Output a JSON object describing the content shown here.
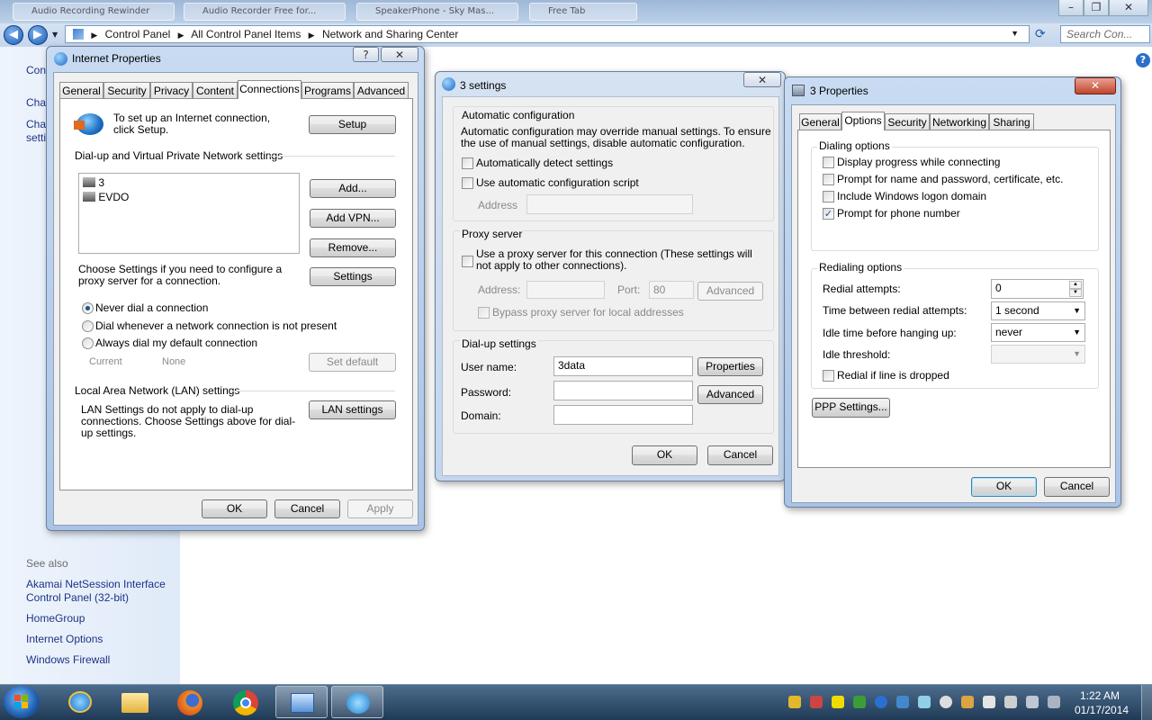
{
  "explorer": {
    "tabs": [
      "Audio Recording Rewinder",
      "Audio Recorder Free for...",
      "SpeakerPhone - Sky Mas...",
      "Free Tab"
    ],
    "breadcrumb": [
      "Control Panel",
      "All Control Panel Items",
      "Network and Sharing Center"
    ],
    "search_placeholder": "Search Con...",
    "left_partial": [
      "Con",
      "Cha",
      "Cha",
      "setti"
    ],
    "see_also_label": "See also",
    "see_also_links": [
      "Akamai NetSession Interface Control Panel (32-bit)",
      "HomeGroup",
      "Internet Options",
      "Windows Firewall"
    ]
  },
  "inet": {
    "title": "Internet Properties",
    "tabs": [
      "General",
      "Security",
      "Privacy",
      "Content",
      "Connections",
      "Programs",
      "Advanced"
    ],
    "selected_tab": "Connections",
    "setup_text": "To set up an Internet connection, click Setup.",
    "setup_btn": "Setup",
    "dialup_heading": "Dial-up and Virtual Private Network settings",
    "connections": [
      "3",
      "EVDO"
    ],
    "add_btn": "Add...",
    "addvpn_btn": "Add VPN...",
    "remove_btn": "Remove...",
    "choose_text": "Choose Settings if you need to configure a proxy server for a connection.",
    "settings_btn": "Settings",
    "radios": [
      "Never dial a connection",
      "Dial whenever a network connection is not present",
      "Always dial my default connection"
    ],
    "selected_radio": "Never dial a connection",
    "current_label": "Current",
    "current_value": "None",
    "setdefault_btn": "Set default",
    "lan_heading": "Local Area Network (LAN) settings",
    "lan_text": "LAN Settings do not apply to dial-up connections. Choose Settings above for dial-up settings.",
    "lan_btn": "LAN settings",
    "ok": "OK",
    "cancel": "Cancel",
    "apply": "Apply"
  },
  "settings3": {
    "title": "3 settings",
    "auto_heading": "Automatic configuration",
    "auto_text": "Automatic configuration may override manual settings.  To ensure the use of manual settings, disable automatic configuration.",
    "auto_detect": "Automatically detect settings",
    "auto_script": "Use automatic configuration script",
    "address_label": "Address",
    "proxy_heading": "Proxy server",
    "proxy_use": "Use a proxy server for this connection (These settings will not apply to other connections).",
    "proxy_address_label": "Address:",
    "port_label": "Port:",
    "port_value": "80",
    "advanced_btn": "Advanced",
    "bypass": "Bypass proxy server for local addresses",
    "dialup_heading": "Dial-up settings",
    "username_label": "User name:",
    "username_value": "3data",
    "password_label": "Password:",
    "domain_label": "Domain:",
    "properties_btn": "Properties",
    "advanced2_btn": "Advanced",
    "ok": "OK",
    "cancel": "Cancel"
  },
  "props3": {
    "title": "3 Properties",
    "tabs": [
      "General",
      "Options",
      "Security",
      "Networking",
      "Sharing"
    ],
    "selected_tab": "Options",
    "dialing_heading": "Dialing options",
    "dialing": [
      {
        "label": "Display progress while connecting",
        "checked": false
      },
      {
        "label": "Prompt for name and password, certificate, etc.",
        "checked": false
      },
      {
        "label": "Include Windows logon domain",
        "checked": false
      },
      {
        "label": "Prompt for phone number",
        "checked": true
      }
    ],
    "redial_heading": "Redialing options",
    "redial_attempts_label": "Redial attempts:",
    "redial_attempts_value": "0",
    "time_between_label": "Time between redial attempts:",
    "time_between_value": "1 second",
    "idle_before_label": "Idle time before hanging up:",
    "idle_before_value": "never",
    "idle_threshold_label": "Idle threshold:",
    "redial_dropped": "Redial if line is dropped",
    "ppp_btn": "PPP Settings...",
    "ok": "OK",
    "cancel": "Cancel"
  },
  "taskbar": {
    "time": "1:22 AM",
    "date": "01/17/2014"
  }
}
